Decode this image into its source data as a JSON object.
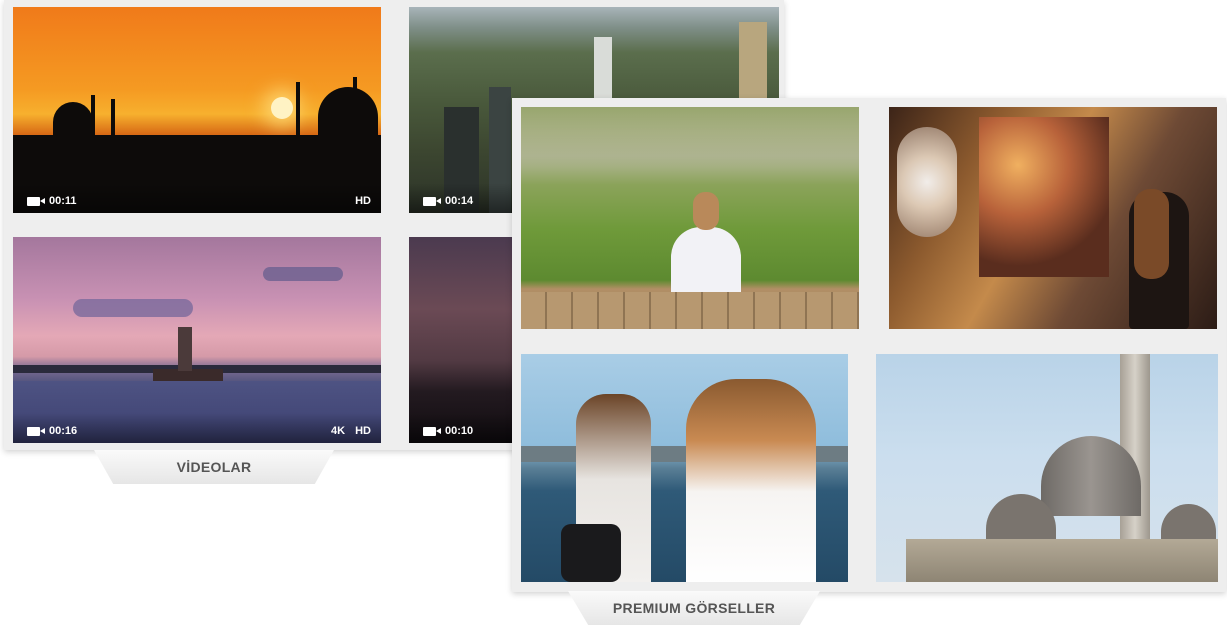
{
  "videos": {
    "tab_label": "VİDEOLAR",
    "items": [
      {
        "duration": "00:11",
        "qualities": [
          "HD"
        ]
      },
      {
        "duration": "00:14",
        "qualities": []
      },
      {
        "duration": "00:16",
        "qualities": [
          "4K",
          "HD"
        ]
      },
      {
        "duration": "00:10",
        "qualities": []
      }
    ]
  },
  "images": {
    "tab_label": "PREMIUM GÖRSELLER"
  },
  "colors": {
    "panel_bg": "#eeeeee",
    "tab_text": "#555555",
    "overlay_text": "#ffffff"
  }
}
